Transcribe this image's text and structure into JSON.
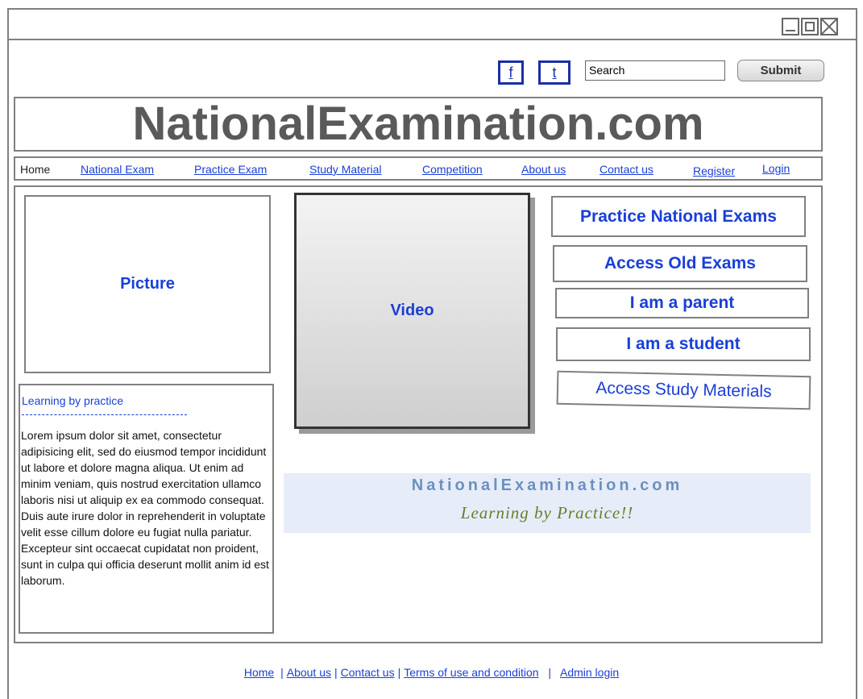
{
  "window_controls": {
    "min": "minimize",
    "max": "maximize",
    "close": "close"
  },
  "header": {
    "facebook_label": "f",
    "twitter_label": "t",
    "search_value": "Search",
    "submit_label": "Submit"
  },
  "banner": {
    "title": "NationalExamination.com"
  },
  "nav": {
    "items": [
      {
        "label": "Home"
      },
      {
        "label": "National Exam"
      },
      {
        "label": "Practice Exam"
      },
      {
        "label": "Study Material"
      },
      {
        "label": "Competition"
      },
      {
        "label": "About us"
      },
      {
        "label": "Contact us"
      },
      {
        "label": "Register"
      },
      {
        "label": "Login"
      }
    ]
  },
  "left": {
    "picture_label": "Picture",
    "heading": "Learning by practice",
    "body": "Lorem ipsum dolor sit amet, consectetur adipisicing elit, sed do eiusmod tempor incididunt ut labore et dolore magna aliqua. Ut enim ad minim veniam, quis nostrud exercitation ullamco laboris nisi ut aliquip ex ea commodo consequat. Duis aute irure dolor in reprehenderit in voluptate velit esse cillum dolore eu fugiat nulla pariatur. Excepteur sint occaecat cupidatat non proident, sunt in culpa qui officia deserunt mollit anim id est laborum."
  },
  "center": {
    "video_label": "Video",
    "tagline_title": "NationalExamination.com",
    "tagline_sub": "Learning by Practice!!"
  },
  "right": {
    "buttons": [
      {
        "label": "Practice National Exams"
      },
      {
        "label": "Access Old Exams"
      },
      {
        "label": "I am a parent"
      },
      {
        "label": "I am a student"
      },
      {
        "label": "Access Study Materials"
      }
    ]
  },
  "footer": {
    "links": [
      {
        "label": "Home"
      },
      {
        "label": "About us"
      },
      {
        "label": "Contact us"
      },
      {
        "label": "Terms of use and condition"
      },
      {
        "label": "Admin login"
      }
    ]
  }
}
